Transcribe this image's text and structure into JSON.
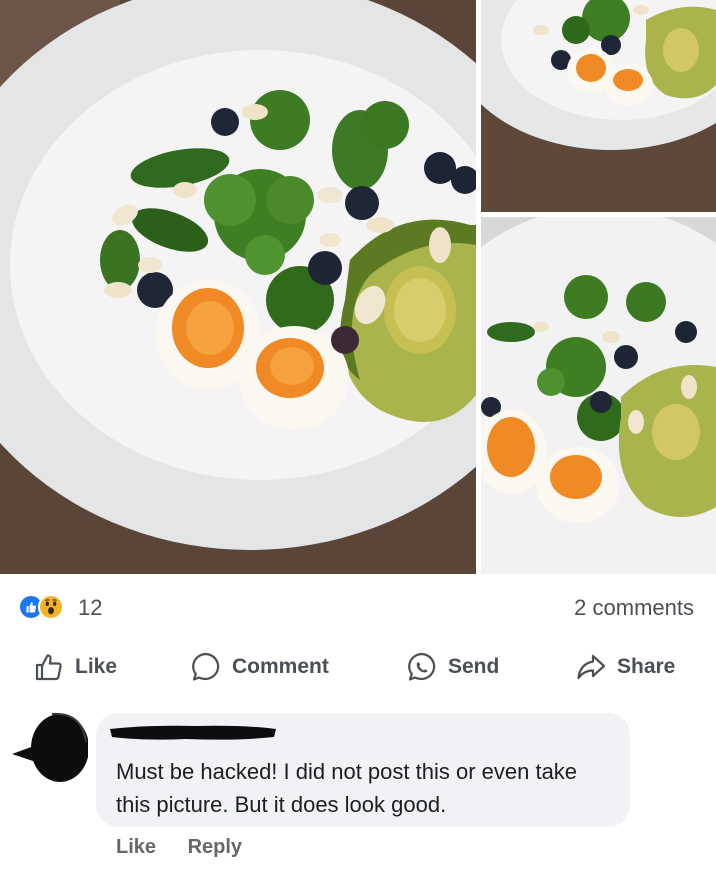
{
  "post": {
    "images": [
      {
        "alt": "main",
        "icon": "salad-photo"
      },
      {
        "alt": "top-right",
        "icon": "salad-photo"
      },
      {
        "alt": "bottom-right",
        "icon": "salad-photo"
      }
    ]
  },
  "reactions": {
    "icons": [
      "like-reaction-icon",
      "wow-reaction-icon"
    ],
    "count": "12",
    "comments_label": "2 comments"
  },
  "actions": {
    "like": "Like",
    "comment": "Comment",
    "send": "Send",
    "share": "Share"
  },
  "comment": {
    "text": "Must be hacked!  I did not post this or even take this picture. But it does look good.",
    "like": "Like",
    "reply": "Reply"
  },
  "colors": {
    "accent": "#1877f2",
    "wow": "#f7b125",
    "bubble": "#f0f2f5",
    "muted_text": "#65676b"
  }
}
